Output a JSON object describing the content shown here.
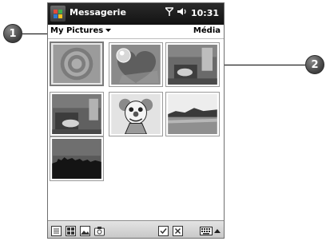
{
  "titlebar": {
    "app_title": "Messagerie",
    "time": "10:31",
    "icons": [
      "start-menu-icon",
      "signal-icon",
      "speaker-icon"
    ]
  },
  "subheader": {
    "folder_label": "My Pictures",
    "media_label": "Média"
  },
  "thumbnails": [
    {
      "name": "thumb-target-circles",
      "selected": true
    },
    {
      "name": "thumb-heart-bubble",
      "selected": false
    },
    {
      "name": "thumb-room-1",
      "selected": false
    },
    {
      "name": "thumb-room-2",
      "selected": false
    },
    {
      "name": "thumb-clown",
      "selected": false
    },
    {
      "name": "thumb-lake",
      "selected": false
    },
    {
      "name": "thumb-city-dusk",
      "selected": false
    }
  ],
  "toolbar": {
    "icons": [
      "list-view-icon",
      "thumbnail-view-icon",
      "picture-icon",
      "camera-icon",
      "checkbox-icon",
      "close-box-icon",
      "keyboard-icon",
      "up-arrow-icon"
    ]
  },
  "callouts": {
    "one": "1",
    "two": "2"
  }
}
